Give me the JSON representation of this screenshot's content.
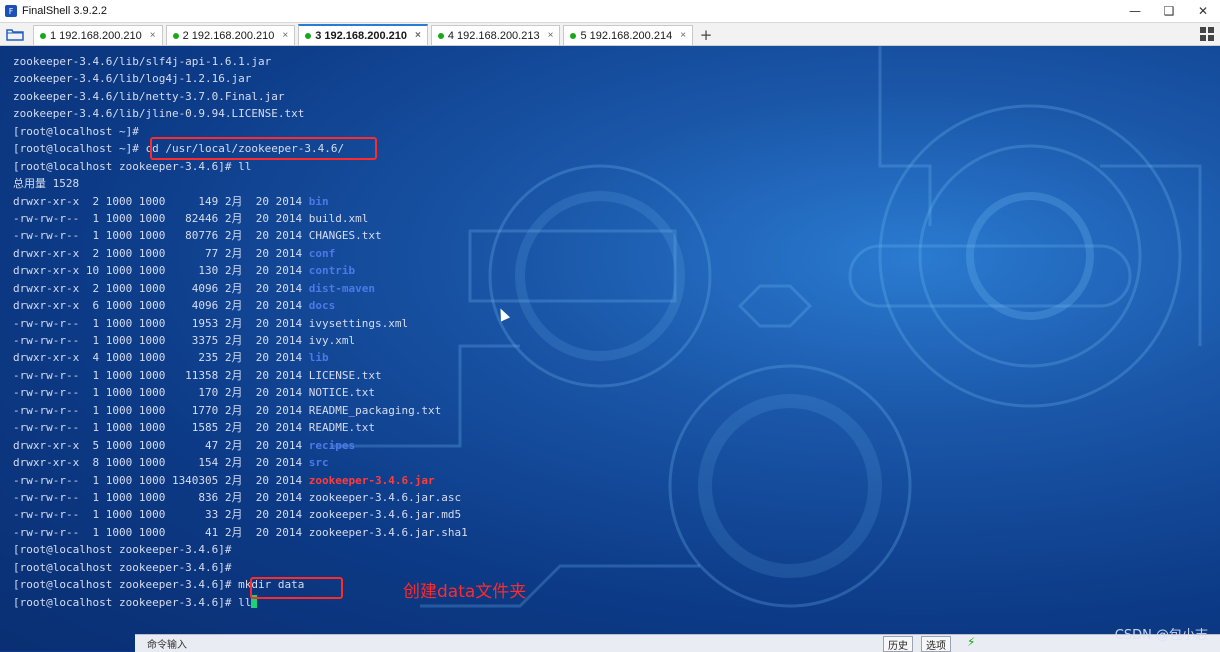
{
  "window": {
    "title": "FinalShell 3.9.2.2",
    "minimize_icon": "minimize-icon",
    "maximize_icon": "maximize-icon",
    "close_icon": "close-icon"
  },
  "tabs": [
    {
      "label": "1 192.168.200.210",
      "active": false
    },
    {
      "label": "2 192.168.200.210",
      "active": false
    },
    {
      "label": "3 192.168.200.210",
      "active": true
    },
    {
      "label": "4 192.168.200.213",
      "active": false
    },
    {
      "label": "5 192.168.200.214",
      "active": false
    }
  ],
  "tab_close_glyph": "×",
  "add_tab_glyph": "+",
  "terminal": {
    "lines": [
      [
        {
          "t": "zookeeper-3.4.6/lib/slf4j-api-1.6.1.jar"
        }
      ],
      [
        {
          "t": "zookeeper-3.4.6/lib/log4j-1.2.16.jar"
        }
      ],
      [
        {
          "t": "zookeeper-3.4.6/lib/netty-3.7.0.Final.jar"
        }
      ],
      [
        {
          "t": "zookeeper-3.4.6/lib/jline-0.9.94.LICENSE.txt"
        }
      ],
      [
        {
          "t": "[root@localhost ~]#"
        }
      ],
      [
        {
          "t": "[root@localhost ~]# cd /usr/local/zookeeper-3.4.6/"
        }
      ],
      [
        {
          "t": "[root@localhost zookeeper-3.4.6]# ll"
        }
      ],
      [
        {
          "t": "总用量 1528"
        }
      ],
      [
        {
          "t": "drwxr-xr-x  2 1000 1000     149 2月  20 2014 "
        },
        {
          "t": "bin",
          "c": "dir"
        }
      ],
      [
        {
          "t": "-rw-rw-r--  1 1000 1000   82446 2月  20 2014 build.xml"
        }
      ],
      [
        {
          "t": "-rw-rw-r--  1 1000 1000   80776 2月  20 2014 CHANGES.txt"
        }
      ],
      [
        {
          "t": "drwxr-xr-x  2 1000 1000      77 2月  20 2014 "
        },
        {
          "t": "conf",
          "c": "dir"
        }
      ],
      [
        {
          "t": "drwxr-xr-x 10 1000 1000     130 2月  20 2014 "
        },
        {
          "t": "contrib",
          "c": "dir"
        }
      ],
      [
        {
          "t": "drwxr-xr-x  2 1000 1000    4096 2月  20 2014 "
        },
        {
          "t": "dist-maven",
          "c": "dir"
        }
      ],
      [
        {
          "t": "drwxr-xr-x  6 1000 1000    4096 2月  20 2014 "
        },
        {
          "t": "docs",
          "c": "dir"
        }
      ],
      [
        {
          "t": "-rw-rw-r--  1 1000 1000    1953 2月  20 2014 ivysettings.xml"
        }
      ],
      [
        {
          "t": "-rw-rw-r--  1 1000 1000    3375 2月  20 2014 ivy.xml"
        }
      ],
      [
        {
          "t": "drwxr-xr-x  4 1000 1000     235 2月  20 2014 "
        },
        {
          "t": "lib",
          "c": "dir"
        }
      ],
      [
        {
          "t": "-rw-rw-r--  1 1000 1000   11358 2月  20 2014 LICENSE.txt"
        }
      ],
      [
        {
          "t": "-rw-rw-r--  1 1000 1000     170 2月  20 2014 NOTICE.txt"
        }
      ],
      [
        {
          "t": "-rw-rw-r--  1 1000 1000    1770 2月  20 2014 README_packaging.txt"
        }
      ],
      [
        {
          "t": "-rw-rw-r--  1 1000 1000    1585 2月  20 2014 README.txt"
        }
      ],
      [
        {
          "t": "drwxr-xr-x  5 1000 1000      47 2月  20 2014 "
        },
        {
          "t": "recipes",
          "c": "dir"
        }
      ],
      [
        {
          "t": "drwxr-xr-x  8 1000 1000     154 2月  20 2014 "
        },
        {
          "t": "src",
          "c": "dir"
        }
      ],
      [
        {
          "t": "-rw-rw-r--  1 1000 1000 1340305 2月  20 2014 "
        },
        {
          "t": "zookeeper-3.4.6.jar",
          "c": "jar"
        }
      ],
      [
        {
          "t": "-rw-rw-r--  1 1000 1000     836 2月  20 2014 zookeeper-3.4.6.jar.asc"
        }
      ],
      [
        {
          "t": "-rw-rw-r--  1 1000 1000      33 2月  20 2014 zookeeper-3.4.6.jar.md5"
        }
      ],
      [
        {
          "t": "-rw-rw-r--  1 1000 1000      41 2月  20 2014 zookeeper-3.4.6.jar.sha1"
        }
      ],
      [
        {
          "t": "[root@localhost zookeeper-3.4.6]#"
        }
      ],
      [
        {
          "t": "[root@localhost zookeeper-3.4.6]#"
        }
      ],
      [
        {
          "t": "[root@localhost zookeeper-3.4.6]# mkdir data"
        }
      ],
      [
        {
          "t": "[root@localhost zookeeper-3.4.6]# ll"
        }
      ]
    ],
    "annotation": "创建data文件夹",
    "colors": {
      "text": "#d6dcef",
      "dir": "#4c79e8",
      "jar": "#ff3b3b",
      "highlight": "#ff2a2a",
      "cursor": "#1dd17a"
    }
  },
  "command_bar": {
    "label": "命令输入",
    "history_button": "历史",
    "options_button": "选项"
  },
  "watermark": "CSDN @包小志"
}
